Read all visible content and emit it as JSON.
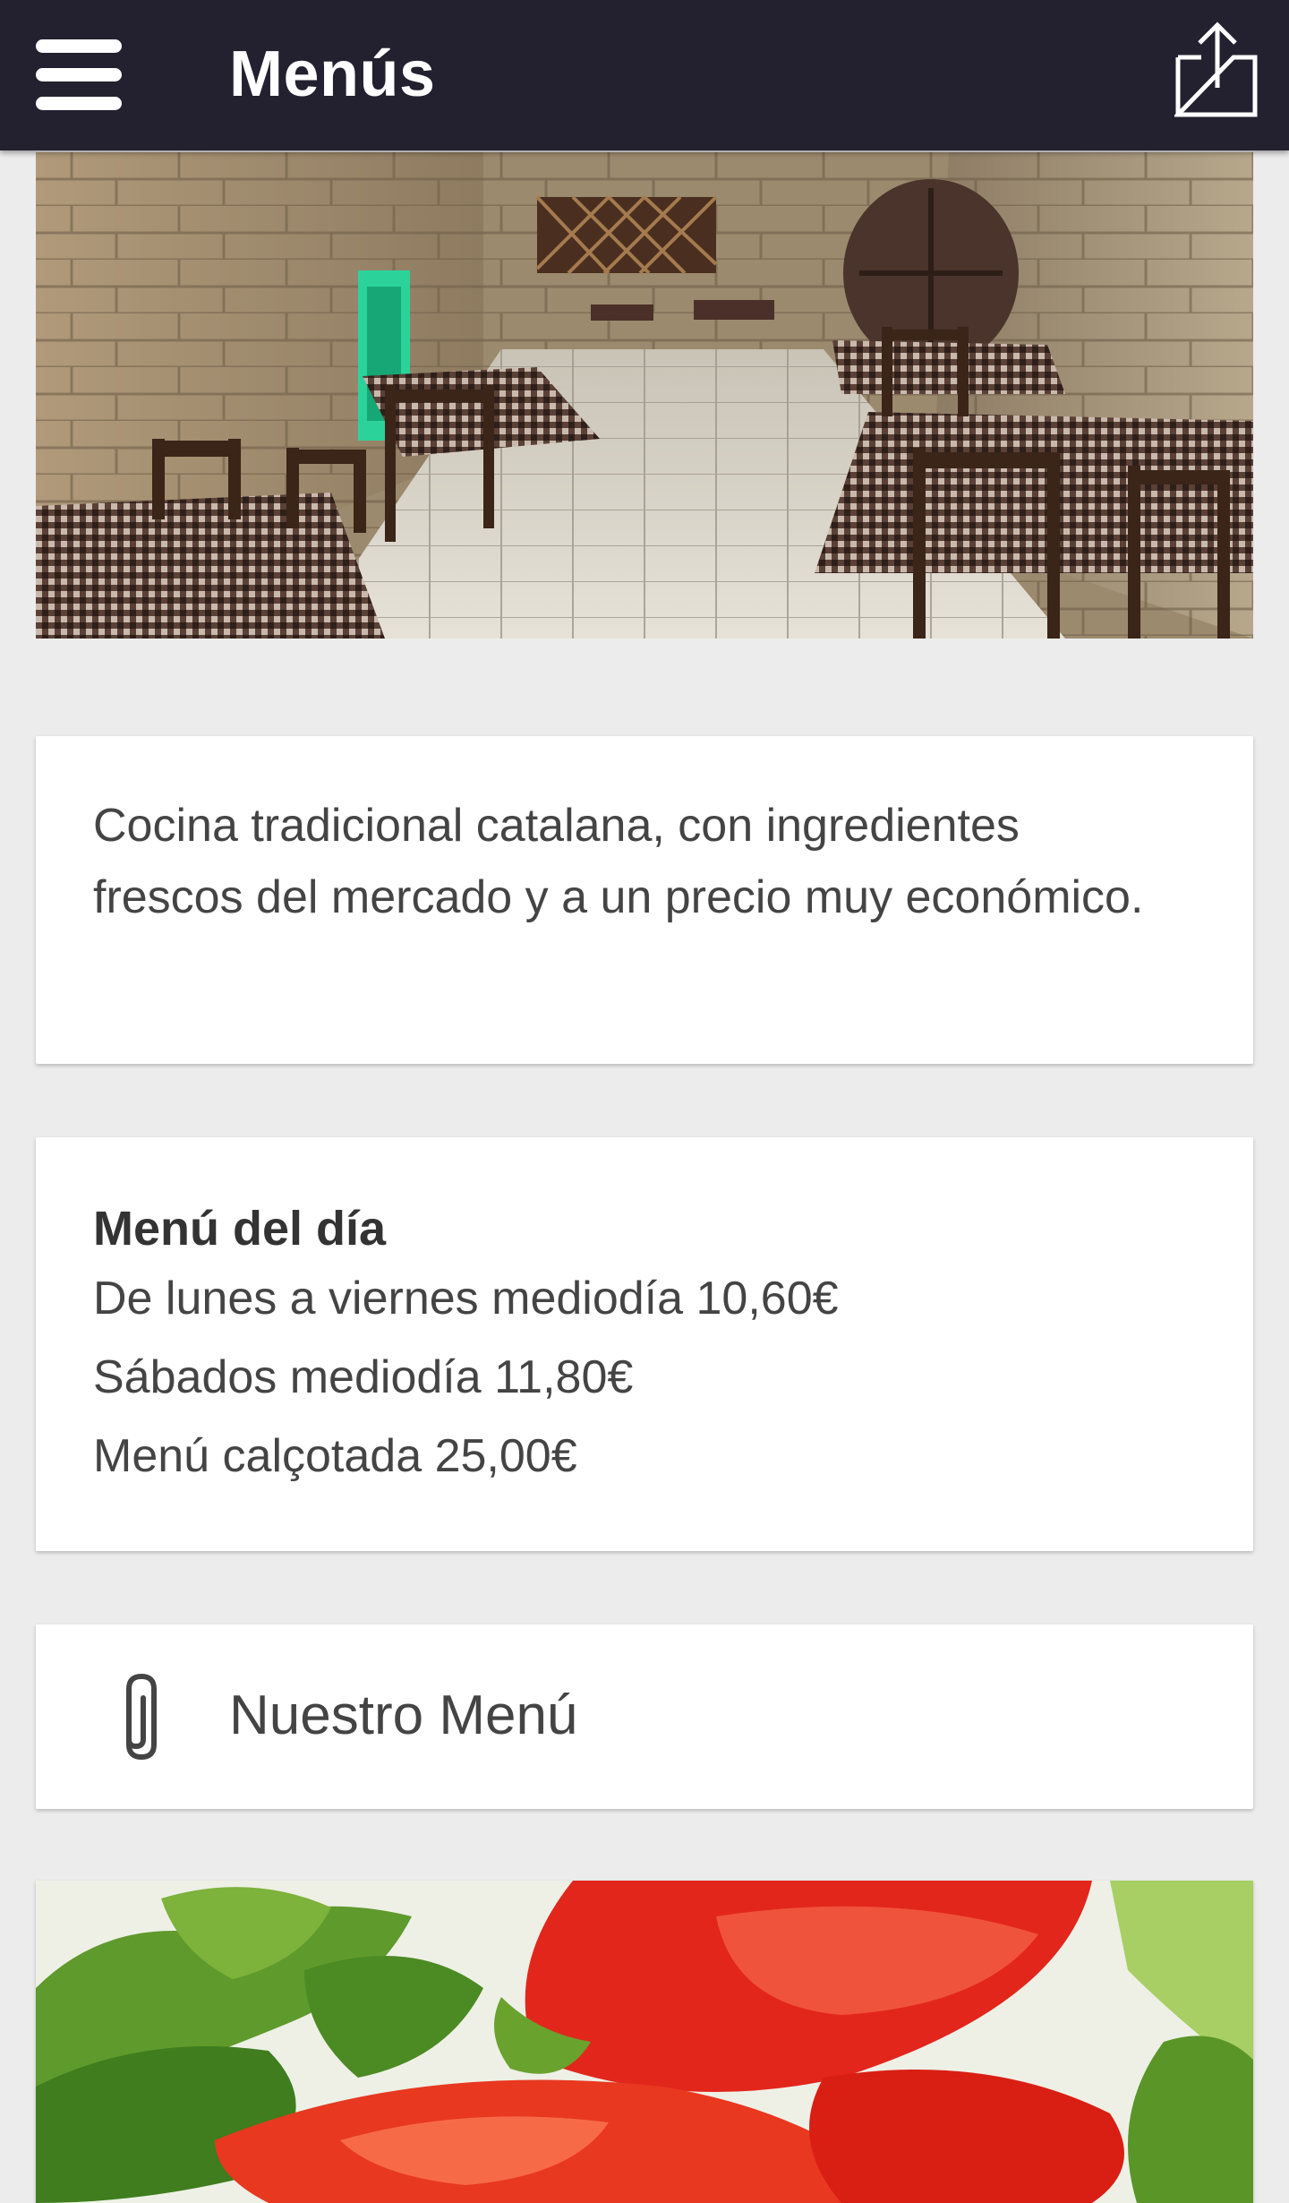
{
  "app_bar": {
    "title": "Menús",
    "menu_icon": "hamburger-menu-icon",
    "share_icon": "share-icon",
    "background_color": "#23202f"
  },
  "hero_image": {
    "description_icon": "restaurant-interior-photo"
  },
  "description_card": {
    "text": "Cocina tradicional catalana, con ingredientes frescos del mercado y a un precio muy económico."
  },
  "menu_card": {
    "heading": "Menú del día",
    "lines": [
      "De lunes a viernes mediodía 10,60€",
      "Sábados mediodía 11,80€",
      "Menú calçotada 25,00€"
    ]
  },
  "attachment_card": {
    "icon": "paperclip-icon",
    "label": "Nuestro Menú"
  },
  "food_image": {
    "description_icon": "vegetables-photo"
  }
}
